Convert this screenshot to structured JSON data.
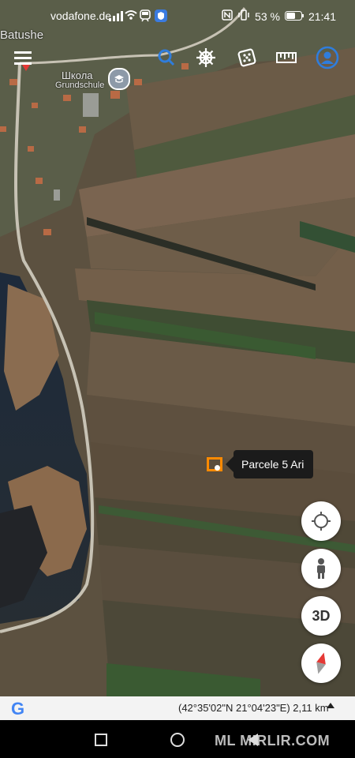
{
  "status_bar": {
    "carrier": "vodafone.de",
    "battery": "53 %",
    "time": "21:41"
  },
  "map": {
    "place_labels": {
      "village": "Batushe",
      "school_cyrillic": "Школа",
      "school_german": "Grundschule"
    },
    "marker": {
      "label": "Parcele 5 Ari",
      "color": "#ff8a00"
    }
  },
  "toolbar": {
    "icons": [
      "menu-icon",
      "search-icon",
      "helm-icon",
      "dice-icon",
      "ruler-icon",
      "account-icon"
    ],
    "accent": "#2f7ddc"
  },
  "controls": {
    "view_3d_label": "3D"
  },
  "footer": {
    "logo": "G",
    "coordinates": "(42°35'02\"N 21°04'23\"E) 2,11 km"
  },
  "watermark": "ML MIRLIR.COM"
}
